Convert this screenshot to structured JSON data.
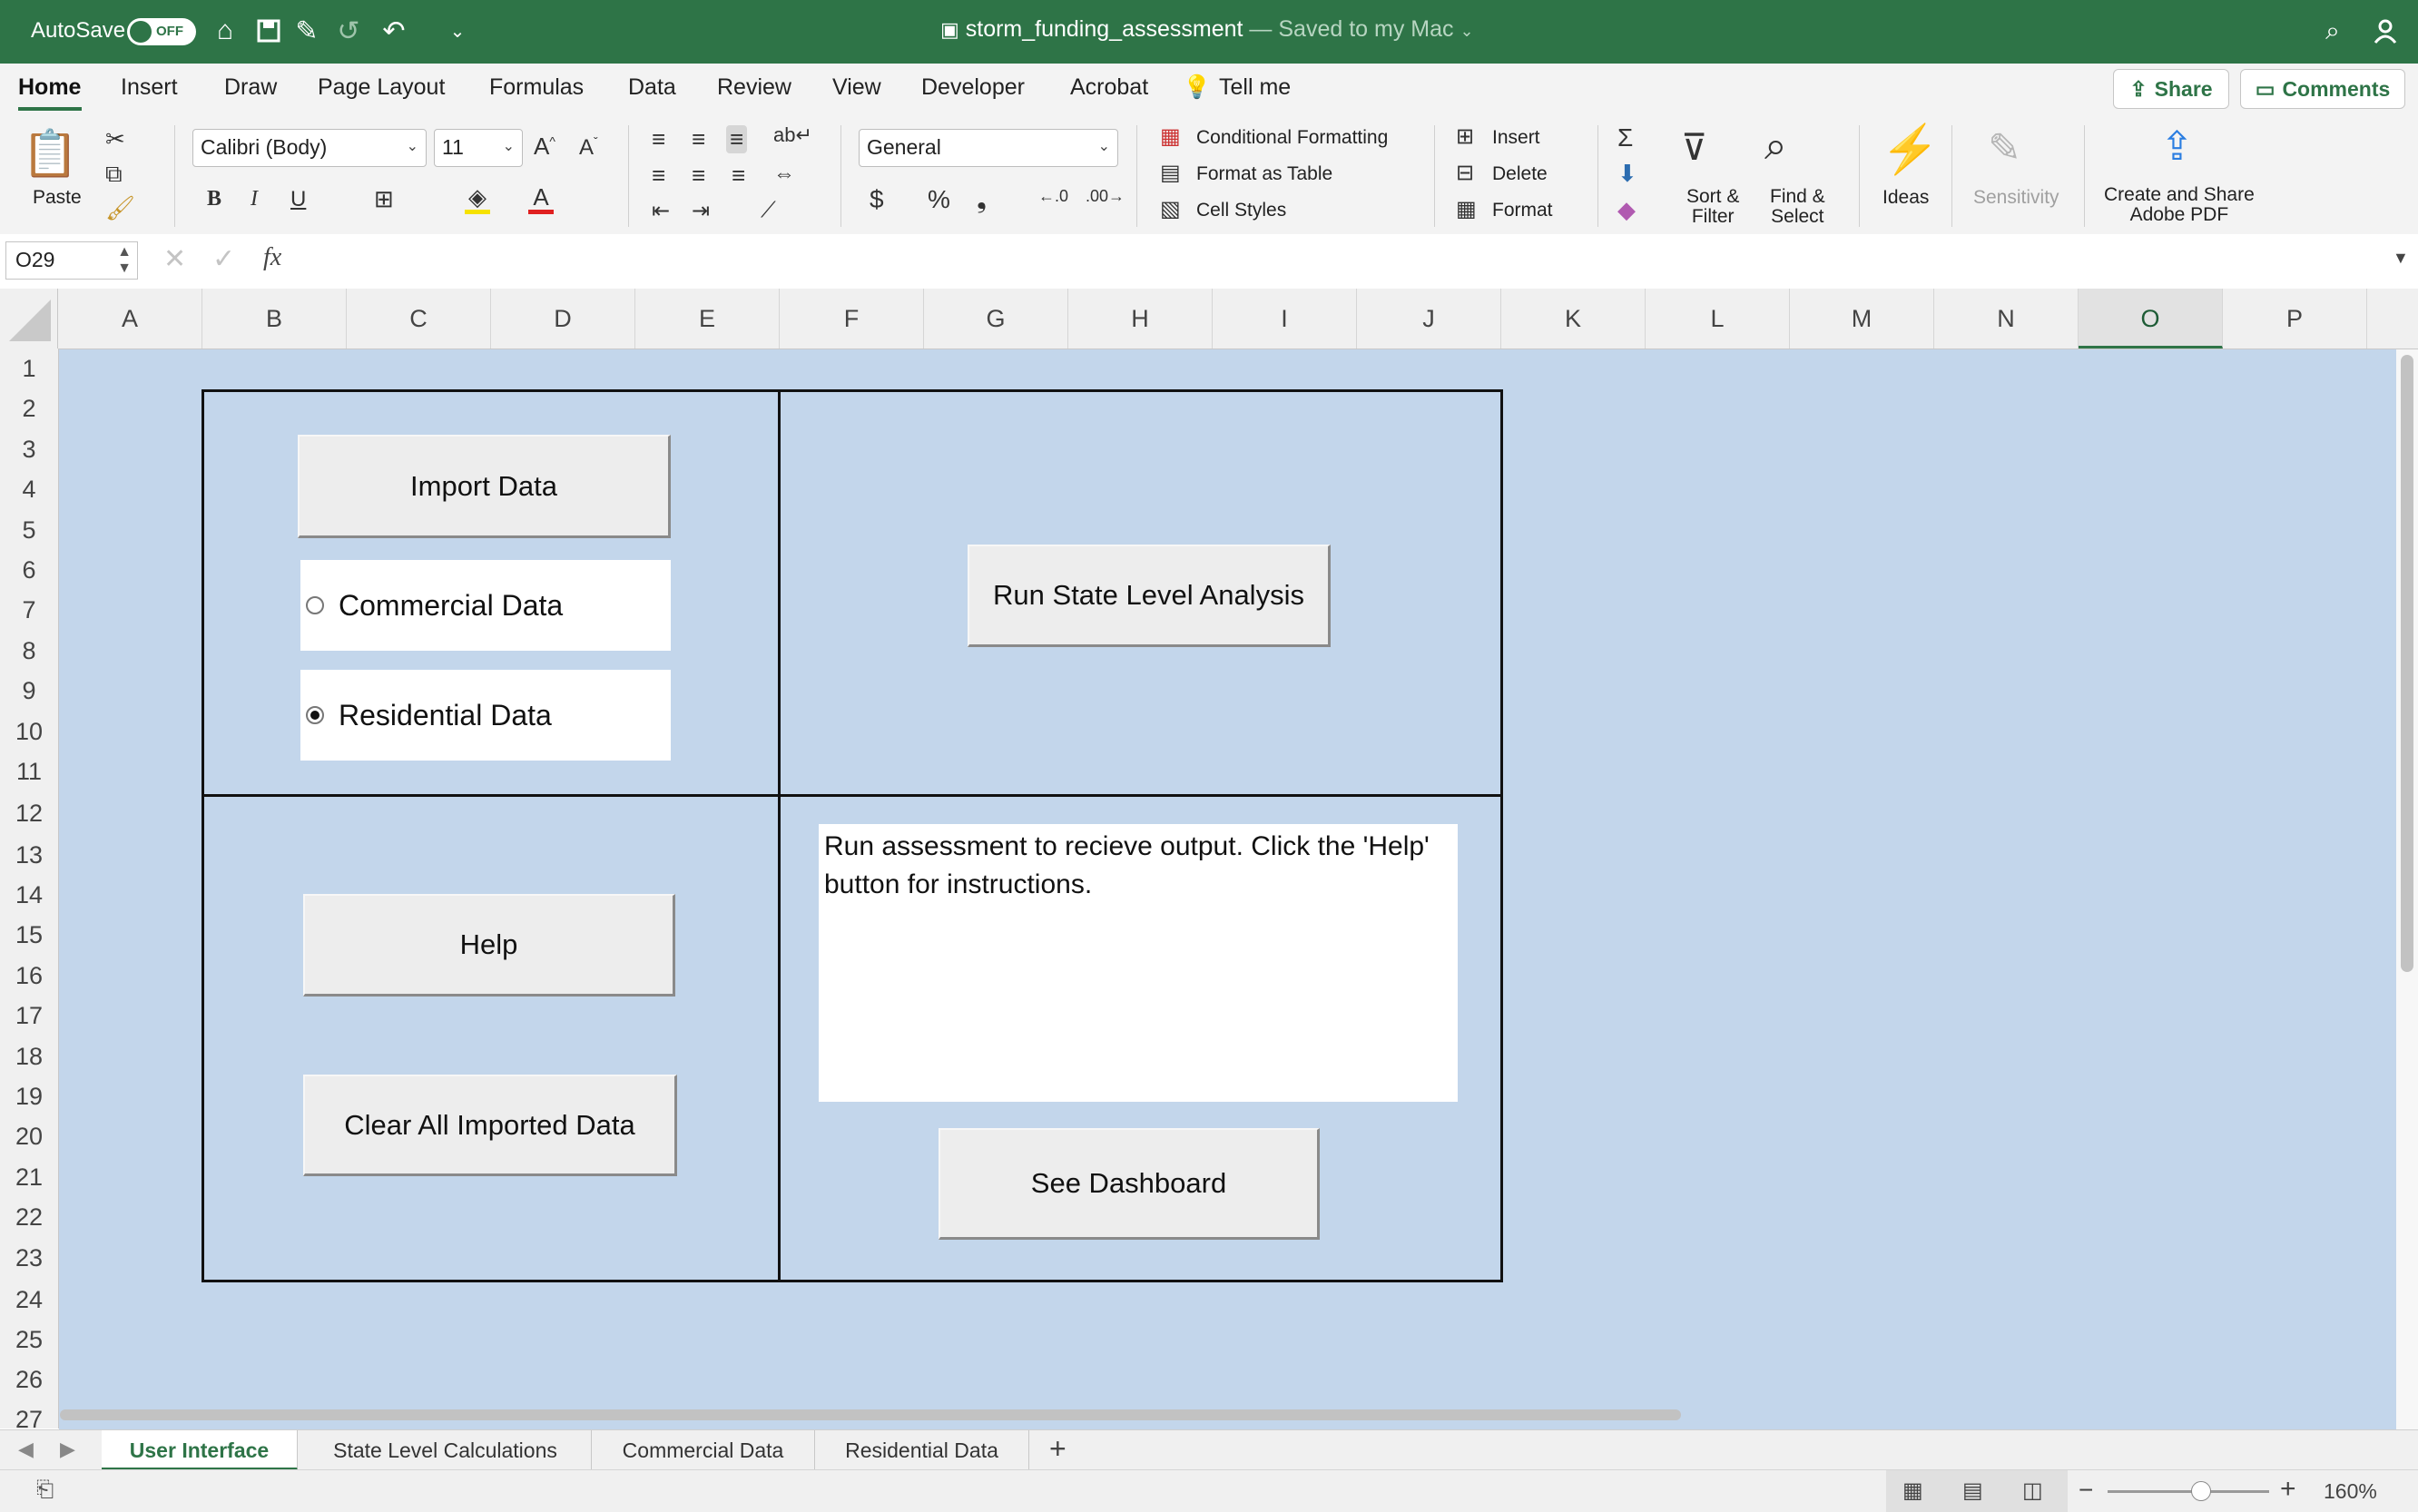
{
  "titlebar": {
    "autosave_label": "AutoSave",
    "autosave_state": "OFF",
    "doc_title": "storm_funding_assessment",
    "save_status": "— Saved to my Mac"
  },
  "ribbon_tabs": [
    "Home",
    "Insert",
    "Draw",
    "Page Layout",
    "Formulas",
    "Data",
    "Review",
    "View",
    "Developer",
    "Acrobat",
    "Tell me"
  ],
  "share": {
    "share_label": "Share",
    "comments_label": "Comments"
  },
  "ribbon": {
    "paste_label": "Paste",
    "font_name": "Calibri (Body)",
    "font_size": "11",
    "number_format": "General",
    "conditional_formatting": "Conditional Formatting",
    "format_as_table": "Format as Table",
    "cell_styles": "Cell Styles",
    "insert": "Insert",
    "delete": "Delete",
    "format": "Format",
    "sort_filter": "Sort &\nFilter",
    "find_select": "Find &\nSelect",
    "ideas": "Ideas",
    "sensitivity": "Sensitivity",
    "create_share_pdf": "Create and Share\nAdobe PDF",
    "bold": "B",
    "italic": "I",
    "underline": "U"
  },
  "formula_bar": {
    "name_box": "O29",
    "fx": "fx",
    "value": ""
  },
  "columns": [
    "A",
    "B",
    "C",
    "D",
    "E",
    "F",
    "G",
    "H",
    "I",
    "J",
    "K",
    "L",
    "M",
    "N",
    "O",
    "P"
  ],
  "selected_column": "O",
  "rows": [
    "1",
    "2",
    "3",
    "4",
    "5",
    "6",
    "7",
    "8",
    "9",
    "10",
    "11",
    "12",
    "13",
    "14",
    "15",
    "16",
    "17",
    "18",
    "19",
    "20",
    "21",
    "22",
    "23",
    "24",
    "25",
    "26",
    "27"
  ],
  "form": {
    "import_button": "Import Data",
    "option_commercial": "Commercial Data",
    "option_residential": "Residential Data",
    "selected_option": "Residential Data",
    "run_button": "Run State Level Analysis",
    "help_button": "Help",
    "clear_button": "Clear All Imported Data",
    "output_text": "Run assessment to recieve output. Click the 'Help' button for instructions.",
    "dashboard_button": "See Dashboard"
  },
  "sheet_tabs": [
    "User Interface",
    "State Level Calculations",
    "Commercial Data",
    "Residential Data"
  ],
  "active_sheet": "User Interface",
  "status": {
    "zoom": "160%"
  },
  "colors": {
    "excel_green": "#2e7447",
    "sheet_bg": "#c3d6eb"
  }
}
